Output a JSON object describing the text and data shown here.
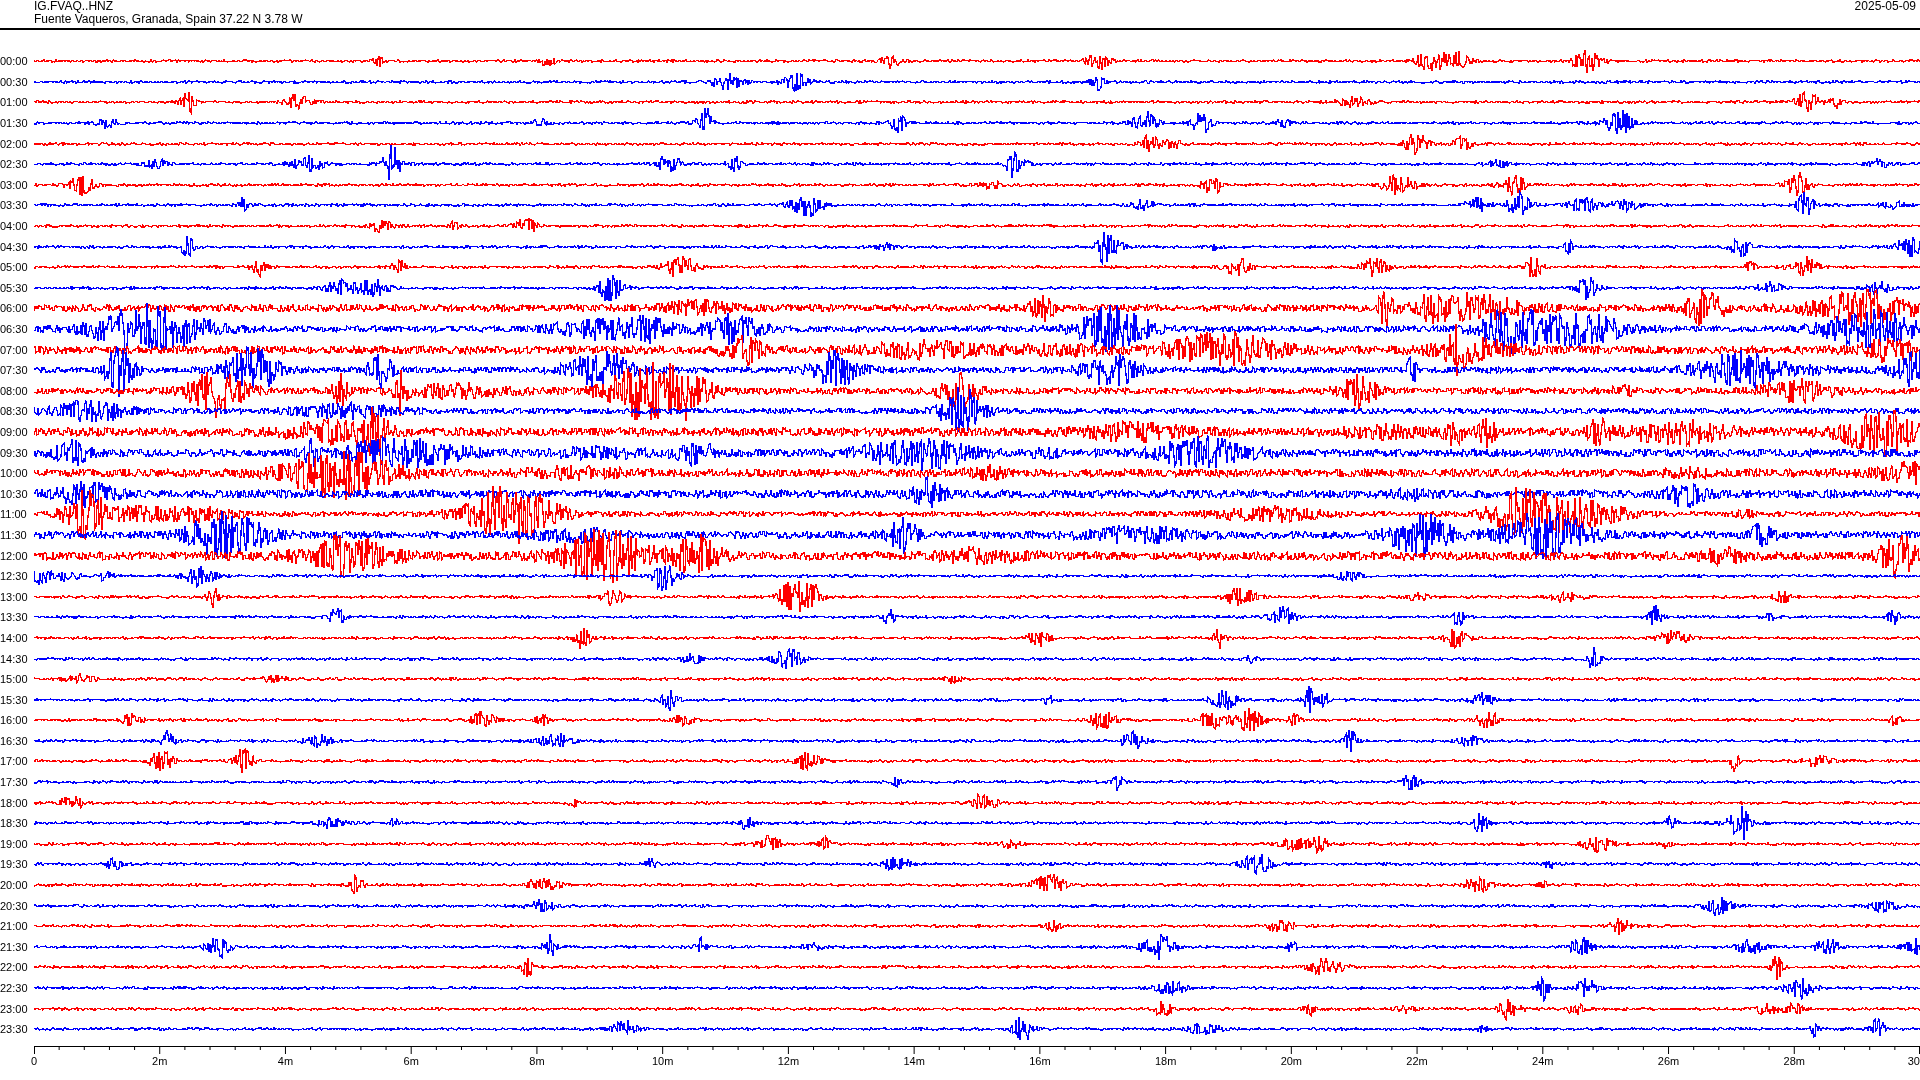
{
  "header": {
    "station": "IG.FVAQ..HNZ",
    "location": "Fuente Vaqueros, Granada, Spain  37.22 N 3.78 W",
    "date": "2025-05-09"
  },
  "traces": [
    {
      "label": "00:00",
      "color": "#ff0000"
    },
    {
      "label": "00:30",
      "color": "#0000ff"
    },
    {
      "label": "01:00",
      "color": "#ff0000"
    },
    {
      "label": "01:30",
      "color": "#0000ff"
    },
    {
      "label": "02:00",
      "color": "#ff0000"
    },
    {
      "label": "02:30",
      "color": "#0000ff"
    },
    {
      "label": "03:00",
      "color": "#ff0000"
    },
    {
      "label": "03:30",
      "color": "#0000ff"
    },
    {
      "label": "04:00",
      "color": "#ff0000"
    },
    {
      "label": "04:30",
      "color": "#0000ff"
    },
    {
      "label": "05:00",
      "color": "#ff0000"
    },
    {
      "label": "05:30",
      "color": "#0000ff"
    },
    {
      "label": "06:00",
      "color": "#ff0000"
    },
    {
      "label": "06:30",
      "color": "#0000ff"
    },
    {
      "label": "07:00",
      "color": "#ff0000"
    },
    {
      "label": "07:30",
      "color": "#0000ff"
    },
    {
      "label": "08:00",
      "color": "#ff0000"
    },
    {
      "label": "08:30",
      "color": "#0000ff"
    },
    {
      "label": "09:00",
      "color": "#ff0000"
    },
    {
      "label": "09:30",
      "color": "#0000ff"
    },
    {
      "label": "10:00",
      "color": "#ff0000"
    },
    {
      "label": "10:30",
      "color": "#0000ff"
    },
    {
      "label": "11:00",
      "color": "#ff0000"
    },
    {
      "label": "11:30",
      "color": "#0000ff"
    },
    {
      "label": "12:00",
      "color": "#ff0000"
    },
    {
      "label": "12:30",
      "color": "#0000ff"
    },
    {
      "label": "13:00",
      "color": "#ff0000"
    },
    {
      "label": "13:30",
      "color": "#0000ff"
    },
    {
      "label": "14:00",
      "color": "#ff0000"
    },
    {
      "label": "14:30",
      "color": "#0000ff"
    },
    {
      "label": "15:00",
      "color": "#ff0000"
    },
    {
      "label": "15:30",
      "color": "#0000ff"
    },
    {
      "label": "16:00",
      "color": "#ff0000"
    },
    {
      "label": "16:30",
      "color": "#0000ff"
    },
    {
      "label": "17:00",
      "color": "#ff0000"
    },
    {
      "label": "17:30",
      "color": "#0000ff"
    },
    {
      "label": "18:00",
      "color": "#ff0000"
    },
    {
      "label": "18:30",
      "color": "#0000ff"
    },
    {
      "label": "19:00",
      "color": "#ff0000"
    },
    {
      "label": "19:30",
      "color": "#0000ff"
    },
    {
      "label": "20:00",
      "color": "#ff0000"
    },
    {
      "label": "20:30",
      "color": "#0000ff"
    },
    {
      "label": "21:00",
      "color": "#ff0000"
    },
    {
      "label": "21:30",
      "color": "#0000ff"
    },
    {
      "label": "22:00",
      "color": "#ff0000"
    },
    {
      "label": "22:30",
      "color": "#0000ff"
    },
    {
      "label": "23:00",
      "color": "#ff0000"
    },
    {
      "label": "23:30",
      "color": "#0000ff"
    }
  ],
  "x_axis": {
    "labels": [
      "0",
      "2m",
      "4m",
      "6m",
      "8m",
      "10m",
      "12m",
      "14m",
      "16m",
      "18m",
      "20m",
      "22m",
      "24m",
      "26m",
      "28m",
      "30"
    ]
  }
}
